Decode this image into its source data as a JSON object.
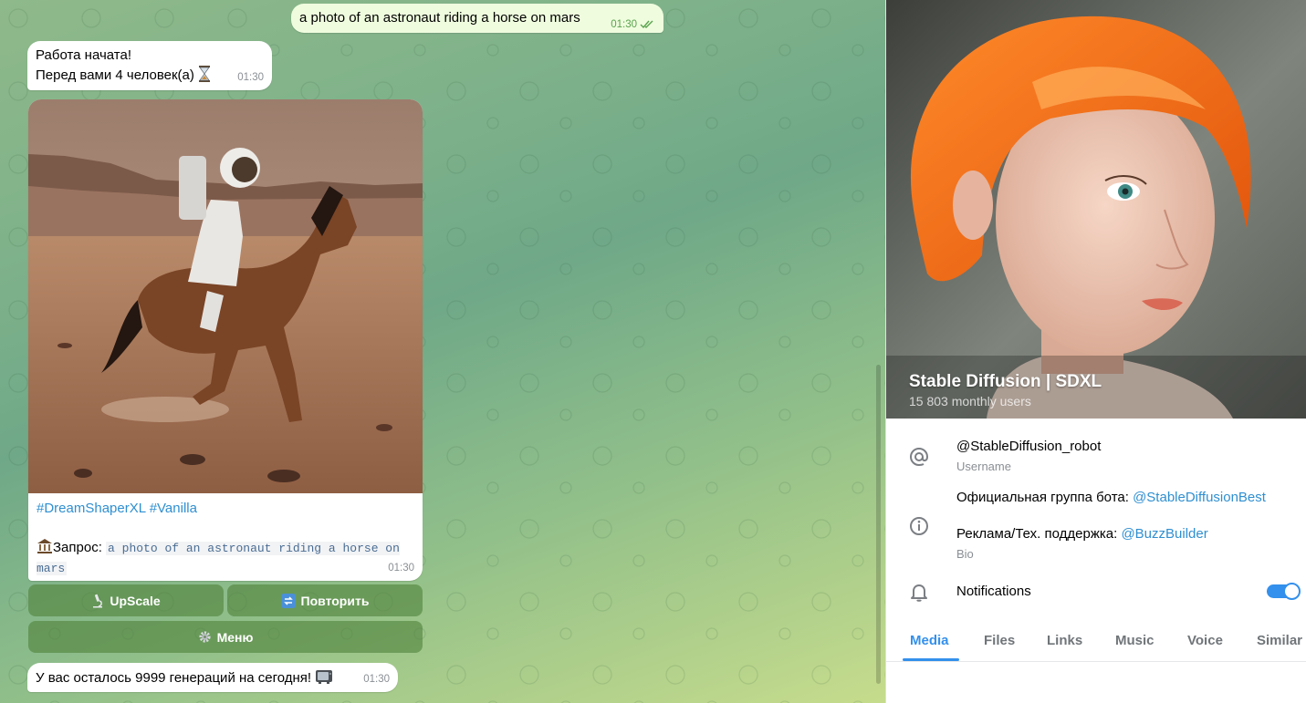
{
  "chat": {
    "outgoing": {
      "text": "a photo of an astronaut riding a horse on mars",
      "time": "01:30"
    },
    "start_message": {
      "line1": "Работа начата!",
      "line2": "Перед вами 4 человек(а)",
      "time": "01:30"
    },
    "image_message": {
      "tags": [
        "#DreamShaperXL",
        "#Vanilla"
      ],
      "prompt_label": "Запрос: ",
      "prompt": "a photo of an astronaut riding a horse on mars",
      "time": "01:30"
    },
    "buttons": {
      "upscale": "UpScale",
      "repeat": "Повторить",
      "menu": "Меню"
    },
    "remaining": {
      "text": "У вас осталось 9999 генераций на сегодня!",
      "time": "01:30"
    }
  },
  "profile": {
    "name": "Stable Diffusion | SDXL",
    "monthly_users": "15 803 monthly users",
    "username": "@StableDiffusion_robot",
    "username_label": "Username",
    "bio_line1_prefix": "Официальная группа бота: ",
    "bio_line1_link": "@StableDiffusionBest",
    "bio_line2_prefix": "Реклама/Тех. поддержка: ",
    "bio_line2_link": "@BuzzBuilder",
    "bio_label": "Bio",
    "notifications_label": "Notifications",
    "notifications_on": true,
    "tabs": [
      "Media",
      "Files",
      "Links",
      "Music",
      "Voice",
      "Similar"
    ],
    "active_tab": "Media"
  },
  "colors": {
    "accent": "#3390ec",
    "link": "#2f8fd1",
    "outgoing_bubble": "#effdde"
  },
  "icons": [
    "double-check-icon",
    "hourglass-icon",
    "microscope-icon",
    "repeat-icon",
    "gear-icon",
    "tv-icon",
    "museum-icon",
    "at-icon",
    "info-icon",
    "bell-icon"
  ]
}
